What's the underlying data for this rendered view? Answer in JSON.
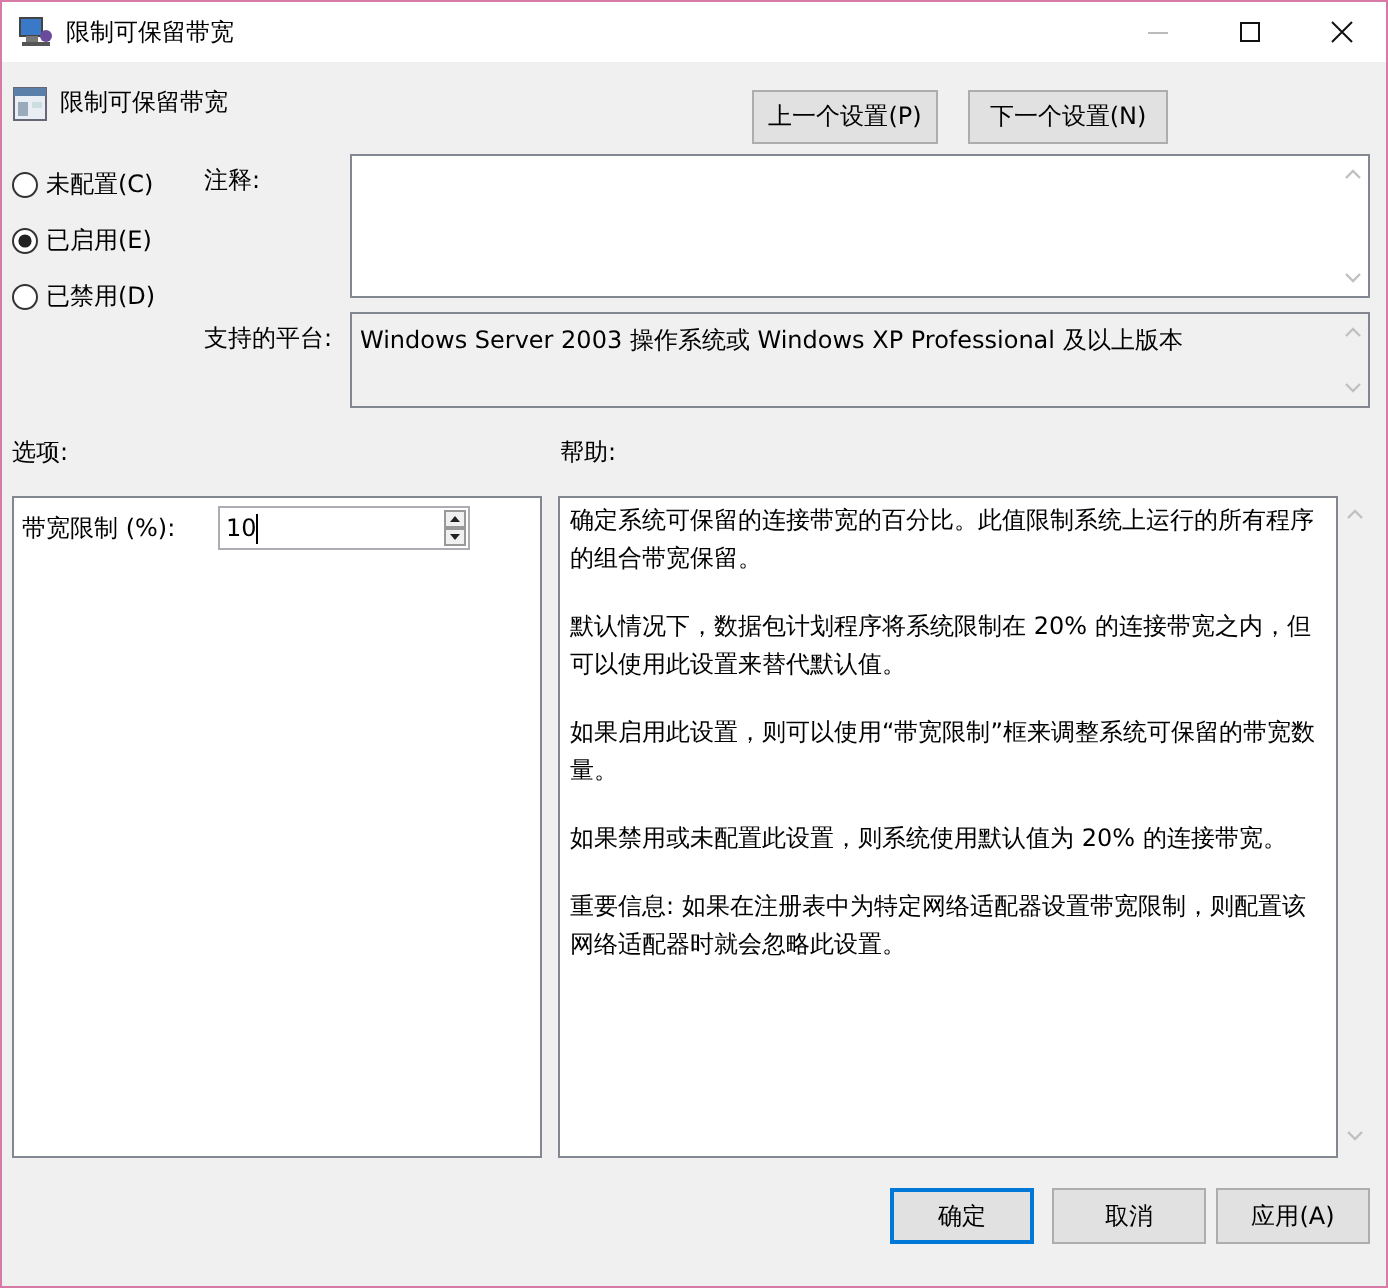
{
  "window": {
    "title": "限制可保留带宽"
  },
  "header": {
    "title": "限制可保留带宽"
  },
  "nav_buttons": [
    {
      "label": "上一个设置(P)"
    },
    {
      "label": "下一个设置(N)"
    }
  ],
  "state_options": [
    {
      "label": "未配置(C)",
      "selected": false
    },
    {
      "label": "已启用(E)",
      "selected": true
    },
    {
      "label": "已禁用(D)",
      "selected": false
    }
  ],
  "comment": {
    "label": "注释:"
  },
  "platform": {
    "label": "支持的平台:",
    "value": "Windows Server 2003 操作系统或 Windows XP Professional 及以上版本"
  },
  "options": {
    "label": "选项:",
    "fields": [
      {
        "label": "带宽限制 (%):",
        "value": "10"
      }
    ]
  },
  "help": {
    "label": "帮助:",
    "paragraphs": [
      "确定系统可保留的连接带宽的百分比。此值限制系统上运行的所有程序的组合带宽保留。",
      "默认情况下，数据包计划程序将系统限制在 20% 的连接带宽之内，但可以使用此设置来替代默认值。",
      "如果启用此设置，则可以使用“带宽限制”框来调整系统可保留的带宽数量。",
      "如果禁用或未配置此设置，则系统使用默认值为 20% 的连接带宽。",
      "重要信息: 如果在注册表中为特定网络适配器设置带宽限制，则配置该网络适配器时就会忽略此设置。"
    ]
  },
  "buttons": [
    {
      "label": "确定",
      "default": true
    },
    {
      "label": "取消",
      "default": false
    },
    {
      "label": "应用(A)",
      "default": false
    }
  ]
}
